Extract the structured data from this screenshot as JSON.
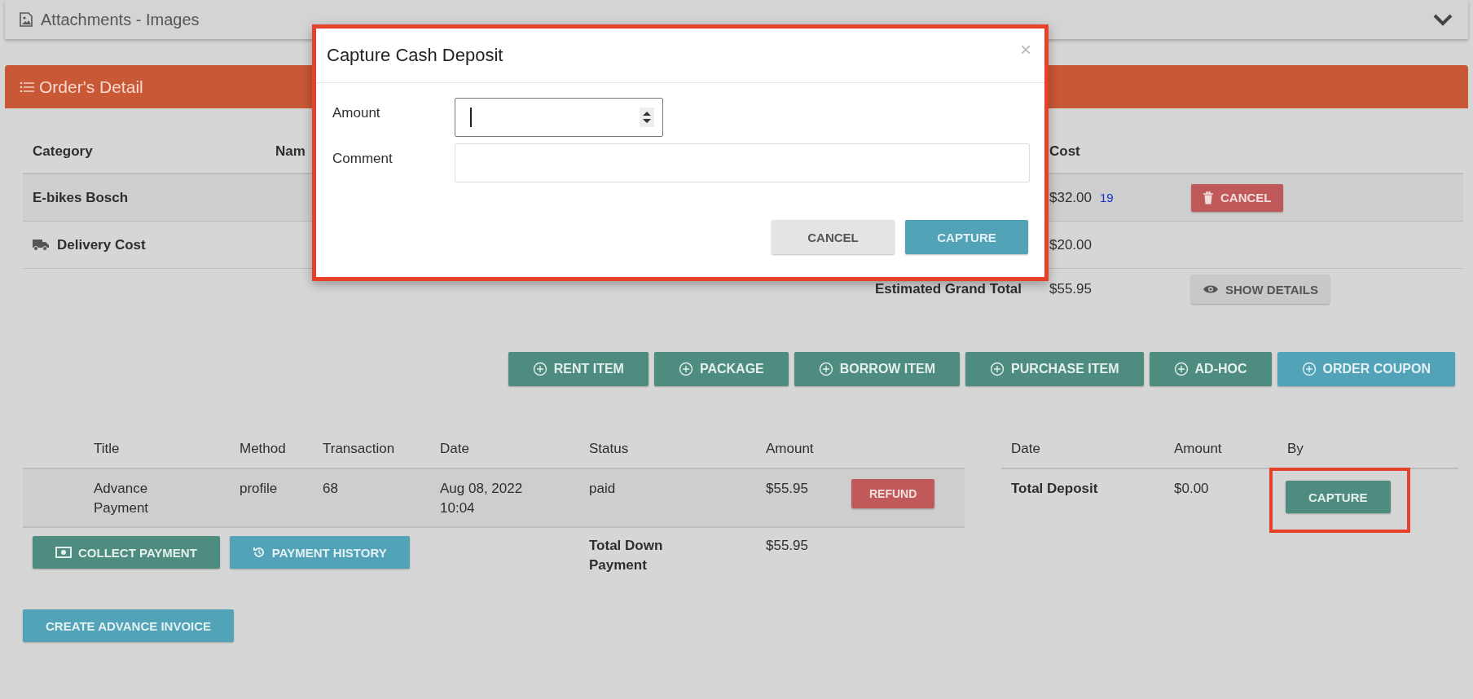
{
  "attachments_panel": {
    "title": "Attachments - Images"
  },
  "order_detail": {
    "title": "Order's Detail",
    "columns": [
      "Category",
      "Nam",
      "Cost"
    ],
    "rows": [
      {
        "kind": "item",
        "category": "E-bikes Bosch",
        "cost": "$32.00",
        "cost_note": "19",
        "action": "CANCEL"
      },
      {
        "kind": "delivery",
        "category": "Delivery Cost",
        "cost": "$20.00"
      }
    ],
    "grand_total": {
      "label": "Estimated Grand Total",
      "value": "$55.95",
      "action": "SHOW DETAILS"
    },
    "add_buttons": [
      {
        "label": "RENT ITEM",
        "kind": "primary"
      },
      {
        "label": "PACKAGE",
        "kind": "primary"
      },
      {
        "label": "BORROW ITEM",
        "kind": "primary"
      },
      {
        "label": "PURCHASE ITEM",
        "kind": "primary"
      },
      {
        "label": "AD-HOC",
        "kind": "primary"
      },
      {
        "label": "ORDER COUPON",
        "kind": "info"
      }
    ]
  },
  "payments": {
    "columns": [
      "Title",
      "Method",
      "Transaction",
      "Date",
      "Status",
      "Amount"
    ],
    "rows": [
      {
        "title": "Advance Payment",
        "method": "profile",
        "transaction": "68",
        "date": "Aug 08, 2022 10:04",
        "status": "paid",
        "amount": "$55.95",
        "action": "REFUND"
      }
    ],
    "buttons": [
      {
        "label": "COLLECT PAYMENT",
        "kind": "primary"
      },
      {
        "label": "PAYMENT HISTORY",
        "kind": "info"
      }
    ],
    "total": {
      "label": "Total Down Payment",
      "value": "$55.95"
    }
  },
  "deposits": {
    "columns": [
      "Date",
      "Amount",
      "By"
    ],
    "total": {
      "label": "Total Deposit",
      "value": "$0.00"
    },
    "action": {
      "label": "CAPTURE",
      "highlighted": true
    }
  },
  "create_invoice_button": "CREATE ADVANCE INVOICE",
  "modal": {
    "title": "Capture Cash Deposit",
    "close": "×",
    "highlighted": true,
    "fields": [
      {
        "kind": "number",
        "label": "Amount",
        "focused": true
      },
      {
        "kind": "text",
        "label": "Comment",
        "focused": false
      }
    ],
    "buttons": [
      {
        "label": "CANCEL",
        "kind": "default"
      },
      {
        "label": "CAPTURE",
        "kind": "info"
      }
    ]
  }
}
